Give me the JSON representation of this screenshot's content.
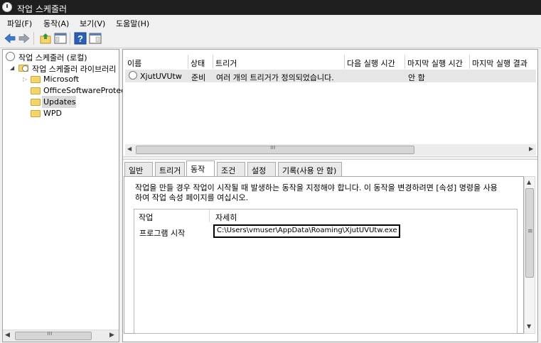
{
  "window": {
    "title": "작업 스케줄러"
  },
  "menu": [
    "파일(F)",
    "동작(A)",
    "보기(V)",
    "도움말(H)"
  ],
  "tree": {
    "root": "작업 스케줄러 (로컬)",
    "library": "작업 스케줄러 라이브러리",
    "folders": [
      "Microsoft",
      "OfficeSoftwareProtect",
      "Updates",
      "WPD"
    ],
    "selected": "Updates"
  },
  "task_list": {
    "columns": [
      "이름",
      "상태",
      "트리거",
      "다음 실행 시간",
      "마지막 실행 시간",
      "마지막 실행 결과"
    ],
    "rows": [
      {
        "name": "XjutUVUtw",
        "status": "준비",
        "trigger": "여러 개의 트리거가 정의되었습니다.",
        "next_run": "",
        "last_run": "안 함",
        "last_result": ""
      }
    ]
  },
  "tabs": [
    "일반",
    "트리거",
    "동작",
    "조건",
    "설정",
    "기록(사용 안 함)"
  ],
  "active_tab": "동작",
  "actions_tab": {
    "description": [
      "작업을 만들 경우 작업이 시작될 때 발생하는 동작을 지정해야 합니다. 이 동작을 변경하려면 [속성] 명령을 사용",
      "하여 작업 속성 페이지를 여십시오."
    ],
    "columns": [
      "작업",
      "자세히"
    ],
    "rows": [
      {
        "action": "프로그램 시작",
        "details": "C:\\Users\\vmuser\\AppData\\Roaming\\XjutUVUtw.exe"
      }
    ]
  },
  "colors": {
    "titlebar": "#1e1e1e",
    "highlight": "#000000",
    "folder": "#f6d467"
  }
}
